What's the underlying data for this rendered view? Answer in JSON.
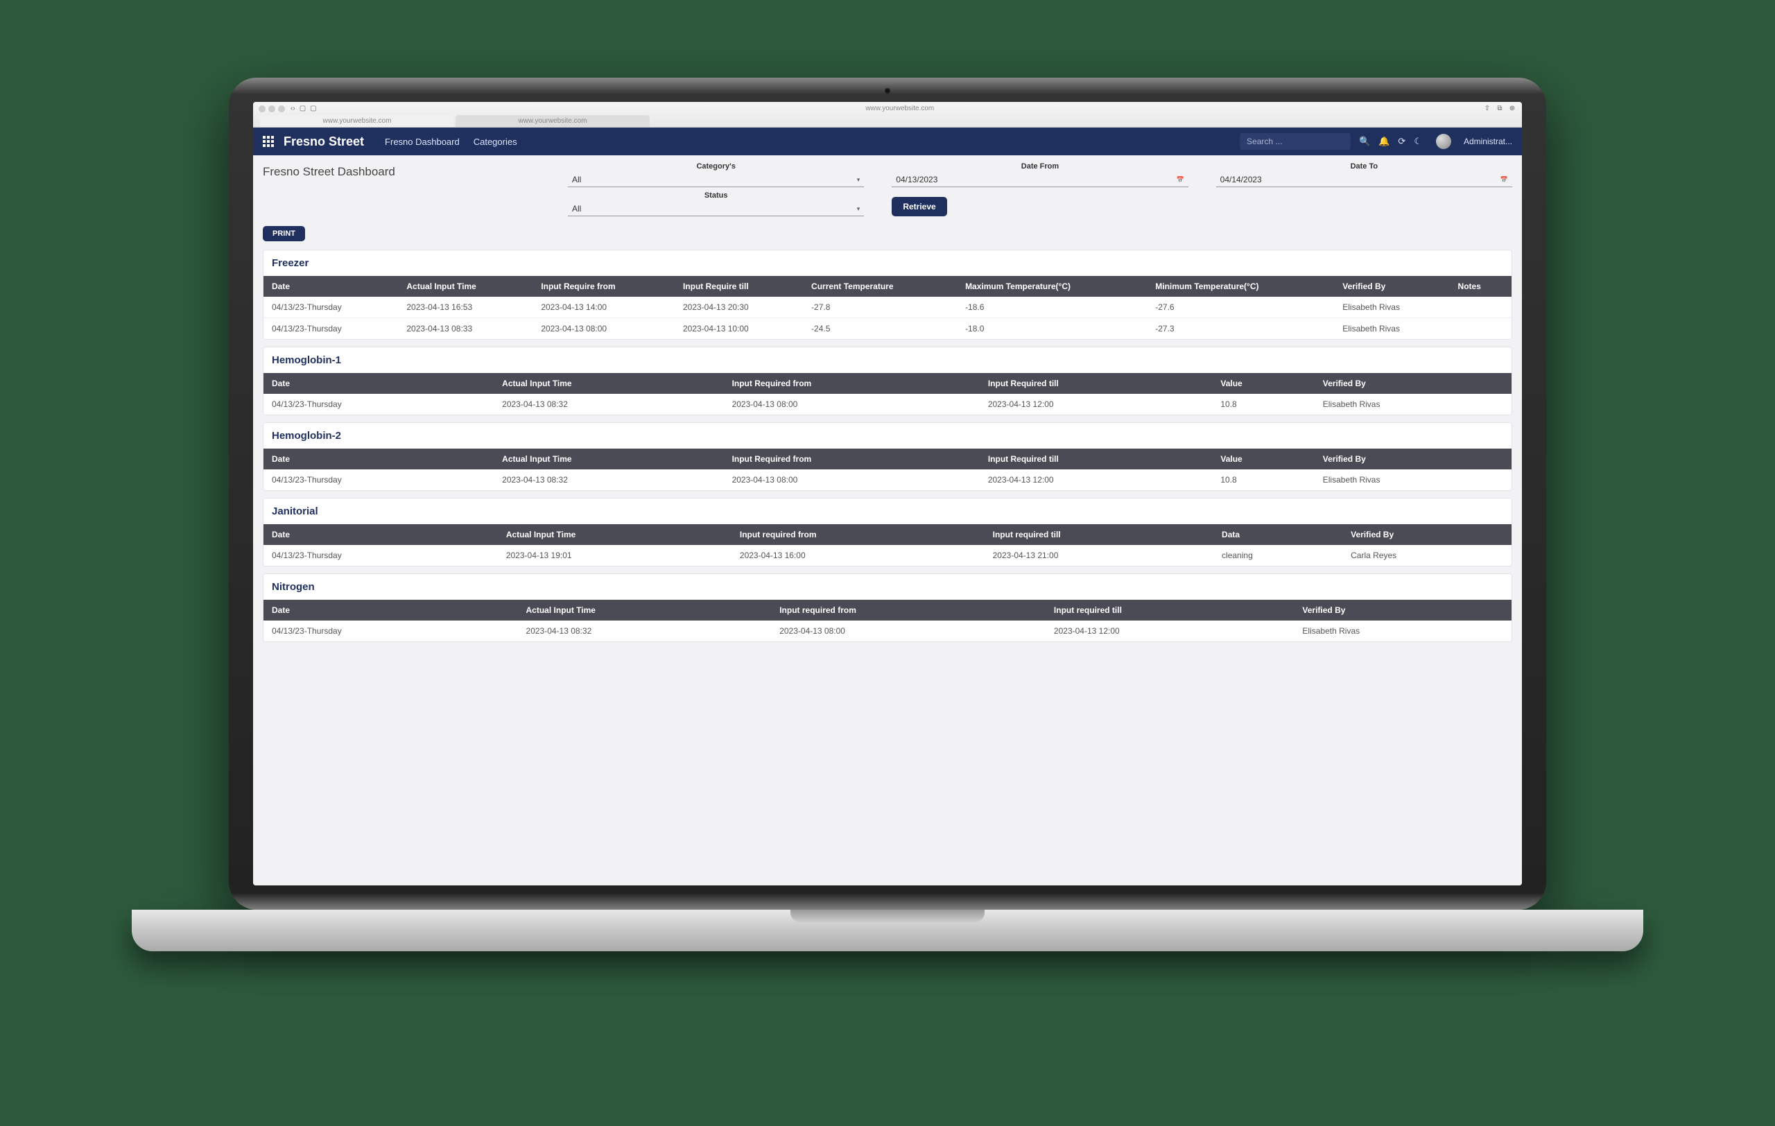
{
  "browser": {
    "url_display": "www.yourwebsite.com",
    "tab1": "www.yourwebsite.com",
    "tab2": "www.yourwebsite.com"
  },
  "header": {
    "app_name": "Fresno Street",
    "nav1": "Fresno Dashboard",
    "nav2": "Categories",
    "search_placeholder": "Search ...",
    "user_label": "Administrat..."
  },
  "subheader": {
    "title": "Fresno Street Dashboard",
    "category_label": "Category's",
    "category_value": "All",
    "status_label": "Status",
    "status_value": "All",
    "date_from_label": "Date From",
    "date_from_value": "04/13/2023",
    "date_to_label": "Date To",
    "date_to_value": "04/14/2023",
    "retrieve_label": "Retrieve",
    "print_label": "PRINT"
  },
  "sections": {
    "freezer": {
      "title": "Freezer",
      "cols": [
        "Date",
        "Actual Input Time",
        "Input Require from",
        "Input Require till",
        "Current Temperature",
        "Maximum Temperature(°C)",
        "Minimum Temperature(°C)",
        "Verified By",
        "Notes"
      ],
      "rows": [
        [
          "04/13/23-Thursday",
          "2023-04-13 16:53",
          "2023-04-13 14:00",
          "2023-04-13 20:30",
          "-27.8",
          "-18.6",
          "-27.6",
          "Elisabeth Rivas",
          ""
        ],
        [
          "04/13/23-Thursday",
          "2023-04-13 08:33",
          "2023-04-13 08:00",
          "2023-04-13 10:00",
          "-24.5",
          "-18.0",
          "-27.3",
          "Elisabeth Rivas",
          ""
        ]
      ]
    },
    "hemoglobin1": {
      "title": "Hemoglobin-1",
      "cols": [
        "Date",
        "Actual Input Time",
        "Input Required from",
        "Input Required till",
        "Value",
        "Verified By"
      ],
      "rows": [
        [
          "04/13/23-Thursday",
          "2023-04-13 08:32",
          "2023-04-13 08:00",
          "2023-04-13 12:00",
          "10.8",
          "Elisabeth Rivas"
        ]
      ]
    },
    "hemoglobin2": {
      "title": "Hemoglobin-2",
      "cols": [
        "Date",
        "Actual Input Time",
        "Input Required from",
        "Input Required till",
        "Value",
        "Verified By"
      ],
      "rows": [
        [
          "04/13/23-Thursday",
          "2023-04-13 08:32",
          "2023-04-13 08:00",
          "2023-04-13 12:00",
          "10.8",
          "Elisabeth Rivas"
        ]
      ]
    },
    "janitorial": {
      "title": "Janitorial",
      "cols": [
        "Date",
        "Actual Input Time",
        "Input required from",
        "Input required till",
        "Data",
        "Verified By"
      ],
      "rows": [
        [
          "04/13/23-Thursday",
          "2023-04-13 19:01",
          "2023-04-13 16:00",
          "2023-04-13 21:00",
          "cleaning",
          "Carla Reyes"
        ]
      ]
    },
    "nitrogen": {
      "title": "Nitrogen",
      "cols": [
        "Date",
        "Actual Input Time",
        "Input required from",
        "Input required till",
        "Verified By"
      ],
      "rows": [
        [
          "04/13/23-Thursday",
          "2023-04-13 08:32",
          "2023-04-13 08:00",
          "2023-04-13 12:00",
          "Elisabeth Rivas"
        ]
      ]
    }
  }
}
